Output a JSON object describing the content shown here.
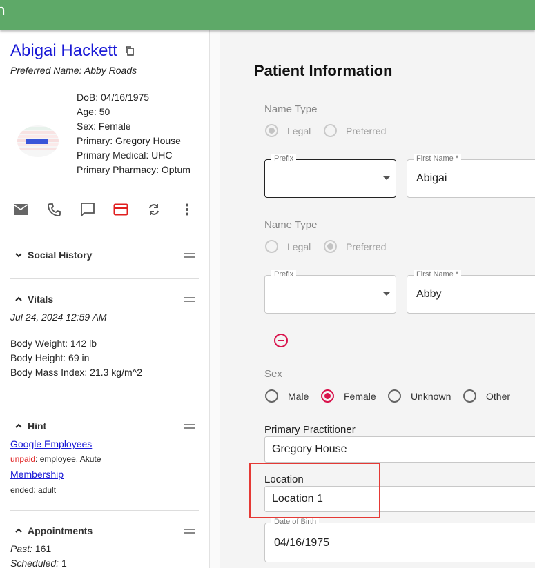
{
  "patient": {
    "name": "Abigai Hackett",
    "preferred_name": "Preferred Name: Abby Roads",
    "dob": "DoB: 04/16/1975",
    "age": "Age: 50",
    "sex": "Sex: Female",
    "primary": "Primary: Gregory House",
    "primary_medical": "Primary Medical: UHC",
    "primary_pharmacy": "Primary Pharmacy: Optum"
  },
  "action_icons": [
    "mail-icon",
    "phone-icon",
    "chat-icon",
    "credit-card-icon",
    "sync-icon",
    "more-vert-icon"
  ],
  "cards": {
    "social_history": {
      "title": "Social History"
    },
    "vitals": {
      "title": "Vitals",
      "date": "Jul 24, 2024 12:59 AM",
      "weight": "Body Weight: 142 lb",
      "height": "Body Height: 69 in",
      "bmi": "Body Mass Index: 21.3 kg/m^2"
    },
    "hint": {
      "title": "Hint",
      "link1": "Google Employees",
      "status1": "unpaid",
      "status1_rest": ": employee, Akute",
      "link2": "Membership",
      "status2": "ended: adult"
    },
    "appointments": {
      "title": "Appointments",
      "past_label": "Past:",
      "past_value": " 161",
      "scheduled_label": "Scheduled:",
      "scheduled_value": " 1"
    }
  },
  "form": {
    "title": "Patient Information",
    "name_type_label": "Name Type",
    "legal": "Legal",
    "preferred": "Preferred",
    "prefix_label": "Prefix",
    "first_name_label": "First Name *",
    "first_name_1": "Abigai",
    "first_name_2": "Abby",
    "sex_label": "Sex",
    "sex_options": [
      "Male",
      "Female",
      "Unknown",
      "Other"
    ],
    "primary_practitioner_label": "Primary Practitioner",
    "primary_practitioner_value": "Gregory House",
    "location_label": "Location",
    "location_value": "Location 1",
    "dob_label": "Date of Birth",
    "dob_value": "04/16/1975"
  },
  "colors": {
    "topbar": "#5ea968",
    "link": "#1a1ad6",
    "accent_red": "#d9134c",
    "highlight": "#e53935"
  }
}
